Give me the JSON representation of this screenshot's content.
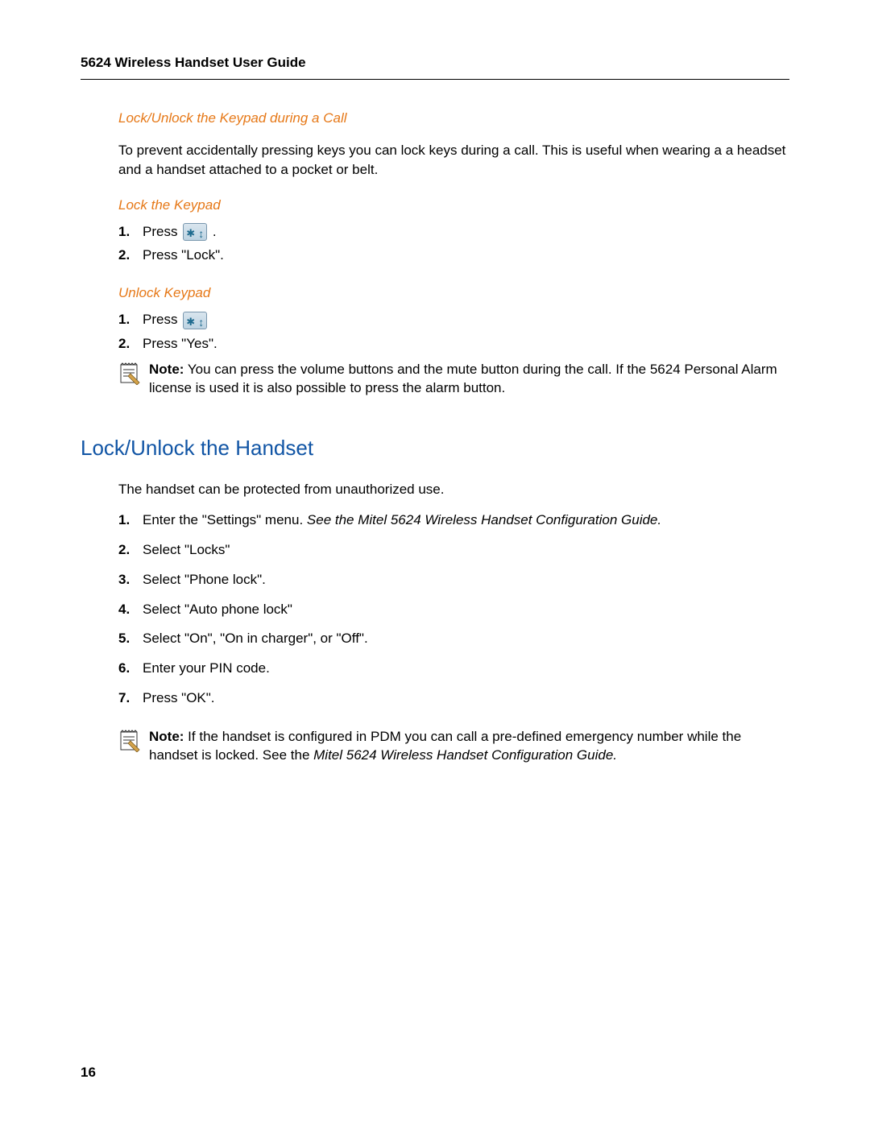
{
  "header": {
    "title": "5624 Wireless Handset User Guide"
  },
  "section1": {
    "heading": "Lock/Unlock the Keypad during a Call",
    "body": "To prevent accidentally pressing keys you can lock keys during a call. This is useful when wearing a a headset and a handset attached to a pocket or belt."
  },
  "lock_keypad": {
    "heading": "Lock the Keypad",
    "step1_prefix": "Press ",
    "step1_suffix": ".",
    "step2": "Press \"Lock\"."
  },
  "unlock_keypad": {
    "heading": "Unlock Keypad",
    "step1": "Press ",
    "step2": "Press \"Yes\"."
  },
  "note1": {
    "label": "Note:",
    "text": " You can press the volume buttons and the mute button during the call. If the 5624 Personal Alarm license is used it is also possible to press the alarm button."
  },
  "section2": {
    "heading": "Lock/Unlock the Handset",
    "body": "The handset can be protected from unauthorized use.",
    "step1_a": "Enter the \"Settings\" menu. ",
    "step1_b": "See the Mitel 5624 Wireless Handset Configuration Guide.",
    "step2": "Select \"Locks\"",
    "step3": "Select \"Phone lock\".",
    "step4": "Select \"Auto phone lock\"",
    "step5": "Select \"On\", \"On in charger\", or \"Off\".",
    "step6": "Enter your PIN code.",
    "step7": "Press \"OK\"."
  },
  "note2": {
    "label": "Note:",
    "text_a": " If the handset is configured in PDM you can call a pre-defined emergency number while the handset is locked. See the ",
    "text_b": "Mitel 5624 Wireless Handset Configuration Guide."
  },
  "page_number": "16"
}
